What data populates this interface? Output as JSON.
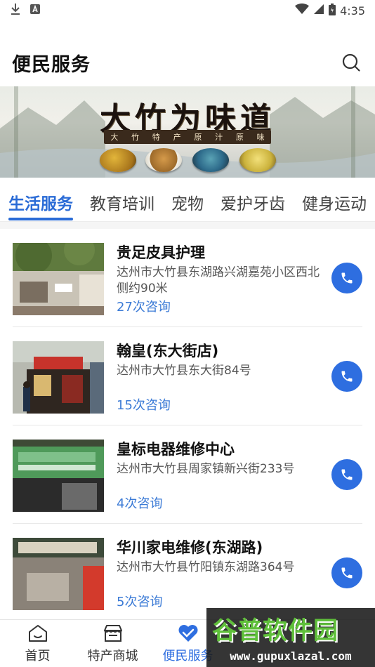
{
  "status_bar": {
    "time": "4:35"
  },
  "header": {
    "title": "便民服务"
  },
  "banner": {
    "title": "大竹为味道",
    "subtitle_chars": [
      "大",
      "竹",
      "特",
      "产",
      "原",
      "汁",
      "原",
      "味"
    ]
  },
  "tabs": [
    {
      "label": "生活服务",
      "active": true
    },
    {
      "label": "教育培训",
      "active": false
    },
    {
      "label": "宠物",
      "active": false
    },
    {
      "label": "爱护牙齿",
      "active": false
    },
    {
      "label": "健身运动",
      "active": false
    }
  ],
  "items": [
    {
      "title": "贵足皮具护理",
      "address": "达州市大竹县东湖路兴湖嘉苑小区西北侧约90米",
      "count": "27次咨询"
    },
    {
      "title": "翰皇(东大街店)",
      "address": "达州市大竹县东大街84号",
      "count": "15次咨询"
    },
    {
      "title": "皇标电器维修中心",
      "address": "达州市大竹县周家镇新兴街233号",
      "count": "4次咨询"
    },
    {
      "title": "华川家电维修(东湖路)",
      "address": "达州市大竹县竹阳镇东湖路364号",
      "count": "5次咨询"
    }
  ],
  "bottom_nav": [
    {
      "label": "首页",
      "icon": "home-icon",
      "active": false
    },
    {
      "label": "特产商城",
      "icon": "store-icon",
      "active": false
    },
    {
      "label": "便民服务",
      "icon": "handshake-heart-icon",
      "active": true
    }
  ],
  "watermark": {
    "main": "谷普软件园",
    "url": "www.gupuxlazal.com"
  },
  "colors": {
    "accent": "#2e6ee0",
    "tab_active": "#2a6bd6",
    "count": "#3c7bd6"
  }
}
